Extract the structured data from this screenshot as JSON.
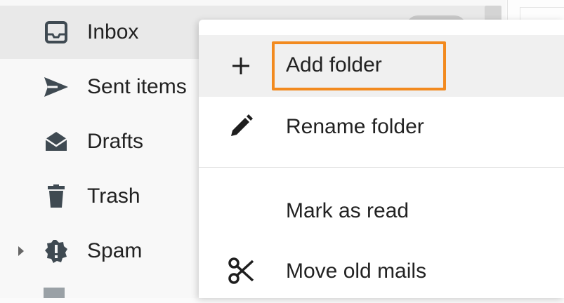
{
  "sidebar": {
    "folders": [
      {
        "label": "Inbox",
        "icon": "inbox-icon"
      },
      {
        "label": "Sent items",
        "icon": "send-icon"
      },
      {
        "label": "Drafts",
        "icon": "drafts-envelope-icon"
      },
      {
        "label": "Trash",
        "icon": "trash-icon"
      },
      {
        "label": "Spam",
        "icon": "spam-warning-icon"
      }
    ]
  },
  "context_menu": {
    "items": [
      {
        "label": "Add folder",
        "icon": "plus-icon"
      },
      {
        "label": "Rename folder",
        "icon": "pencil-icon"
      },
      {
        "label": "Mark as read",
        "icon": ""
      },
      {
        "label": "Move old mails",
        "icon": "scissors-icon"
      }
    ]
  },
  "colors": {
    "focus_outline": "#f28a1f",
    "active_folder_bg": "#e9e9e9",
    "menu_bg": "#ffffff"
  }
}
